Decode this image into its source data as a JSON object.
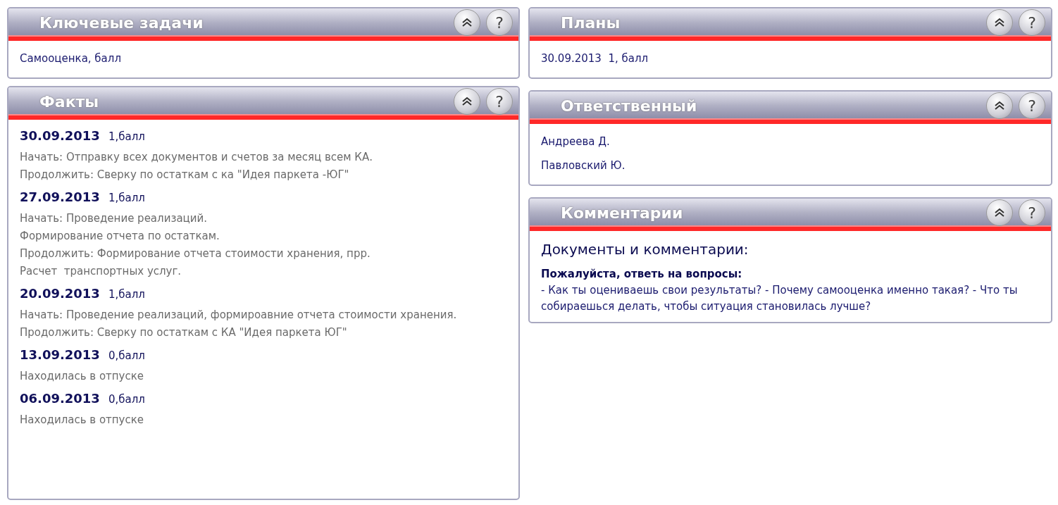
{
  "left_column": [
    {
      "title": "Ключевые задачи",
      "kind": "lines",
      "help": "?",
      "lines": [
        "Самооценка, балл"
      ]
    },
    {
      "title": "Факты",
      "kind": "facts",
      "help": "?",
      "facts": [
        {
          "date": "30.09.2013",
          "score": "1,балл",
          "notes": [
            "Начать: Отправку всех документов и счетов за месяц всем КА.",
            "Продолжить: Сверку по остаткам с ка \"Идея паркета -ЮГ\""
          ]
        },
        {
          "date": "27.09.2013",
          "score": "1,балл",
          "notes": [
            "Начать: Проведение реализаций.",
            "Формирование отчета по остаткам.",
            "Продолжить: Формирование отчета стоимости хранения, прр.",
            "Расчет  транспортных услуг."
          ]
        },
        {
          "date": "20.09.2013",
          "score": "1,балл",
          "notes": [
            "Начать: Проведение реализаций, формироавние отчета стоимости хранения.",
            "Продолжить: Сверку по остаткам с КА \"Идея паркета ЮГ\""
          ]
        },
        {
          "date": "13.09.2013",
          "score": "0,балл",
          "notes": [
            "Находилась в отпуске"
          ]
        },
        {
          "date": "06.09.2013",
          "score": "0,балл",
          "notes": [
            "Находилась в отпуске"
          ]
        }
      ]
    }
  ],
  "right_column": [
    {
      "title": "Планы",
      "kind": "lines",
      "help": "?",
      "lines": [
        "30.09.2013  1, балл"
      ]
    },
    {
      "title": "Ответственный",
      "kind": "lines",
      "help": "?",
      "lines": [
        "Андреева Д.",
        "Павловский Ю."
      ]
    },
    {
      "title": "Комментарии",
      "kind": "comment",
      "help": "?",
      "heading": "Документы и комментарии:",
      "prompt": "Пожалуйста, ответь на вопросы:",
      "text": "- Как ты оцениваешь свои результаты? - Почему самооценка именно такая? - Что ты собираешься делать, чтобы ситуация становилась лучше?"
    }
  ]
}
